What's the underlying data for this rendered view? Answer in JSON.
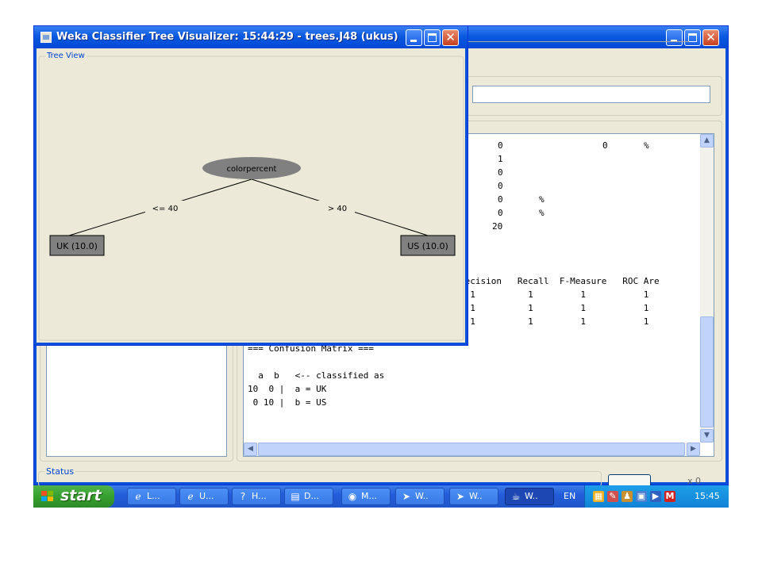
{
  "tree_window": {
    "title": "Weka Classifier Tree Visualizer: 15:44:29 - trees.J48 (ukus)",
    "panel_label": "Tree View",
    "root_node": "colorpercent",
    "edge_left": "<= 40",
    "edge_right": "> 40",
    "leaf_left": "UK (10.0)",
    "leaf_right": "US (10.0)"
  },
  "output": {
    "values_col1": [
      "0",
      "1",
      "0",
      "0",
      "0",
      "0",
      "20"
    ],
    "values_extra": [
      {
        "col": "0",
        "pct": "%"
      },
      {
        "pct": "%"
      },
      {
        "pct": "%"
      }
    ],
    "detail_header": "recision   Recall  F-Measure   ROC Are",
    "detail_rows": [
      "  1          1         1           1",
      "  1          1         1           1",
      "  1          1         1           1"
    ],
    "confusion_title": "=== Confusion Matrix ===",
    "confusion_header": "  a  b   <-- classified as",
    "confusion_row1": "10  0 |  a = UK",
    "confusion_row2": " 0 10 |  b = US"
  },
  "status": {
    "label": "Status",
    "right_text": "x 0"
  },
  "taskbar": {
    "start_label": "start",
    "buttons": [
      {
        "icon": "ie-icon",
        "label": "L..."
      },
      {
        "icon": "ie-icon",
        "label": "U..."
      },
      {
        "icon": "help-icon",
        "label": "H..."
      },
      {
        "icon": "document-icon",
        "label": "D..."
      },
      {
        "icon": "media-icon",
        "label": "M..."
      },
      {
        "icon": "weka-bird-icon",
        "label": "W.."
      },
      {
        "icon": "weka-bird-icon",
        "label": "W.."
      },
      {
        "icon": "java-icon",
        "label": "W.."
      }
    ],
    "language": "EN",
    "clock": "15:45"
  },
  "colors": {
    "xp_title_blue": "#0a5ae0",
    "window_face": "#ece9d8",
    "node_fill": "#808080",
    "start_green": "#37a030",
    "tray_blue": "#1283d6"
  }
}
